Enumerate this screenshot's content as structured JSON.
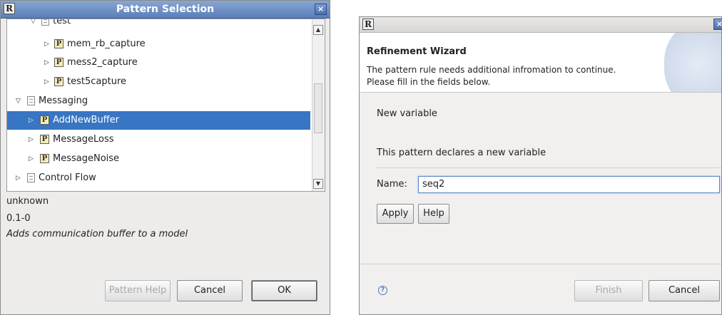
{
  "pattern_selection": {
    "title": "Pattern Selection",
    "close_glyph": "×",
    "logo_letter": "R",
    "tree": [
      {
        "label": "test",
        "icon": "folder-icon",
        "expanded": true
      },
      {
        "label": "mem_rb_capture",
        "icon": "pattern-icon"
      },
      {
        "label": "mess2_capture",
        "icon": "pattern-icon"
      },
      {
        "label": "test5capture",
        "icon": "pattern-icon"
      },
      {
        "label": "Messaging",
        "icon": "folder-icon",
        "expanded": true
      },
      {
        "label": "AddNewBuffer",
        "icon": "pattern-icon",
        "selected": true
      },
      {
        "label": "MessageLoss",
        "icon": "pattern-icon"
      },
      {
        "label": "MessageNoise",
        "icon": "pattern-icon"
      },
      {
        "label": "Control Flow",
        "icon": "folder-icon"
      }
    ],
    "pattern_letter": "P",
    "info": {
      "author": "unknown",
      "version": "0.1-0",
      "description": "Adds communication buffer to a model"
    },
    "buttons": {
      "pattern_help": "Pattern Help",
      "cancel": "Cancel",
      "ok": "OK"
    },
    "selection_color": "#3875c3",
    "title_color": "#5a7fb9"
  },
  "refinement_wizard": {
    "logo_letter": "R",
    "close_glyph": "×",
    "title": "Refinement Wizard",
    "message_line1": "The pattern rule needs additional infromation to continue.",
    "message_line2": "Please fill in the fields below.",
    "section_title": "New variable",
    "section_desc": "This pattern declares a new variable",
    "name_label": "Name:",
    "name_value": "seq2",
    "buttons": {
      "apply": "Apply",
      "help": "Help",
      "finish": "Finish",
      "cancel": "Cancel"
    },
    "help_glyph": "?"
  }
}
